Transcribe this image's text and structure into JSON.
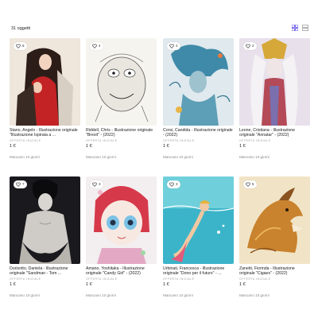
{
  "header": {
    "count_label": "31 oggetti"
  },
  "view_toggle": {
    "active": "grid",
    "accent": "#6b5ce7"
  },
  "items": [
    {
      "fav_count": "8",
      "title": "Stano, Angelo - Illustrazione originale \"Illustrazione Ispirata a ...",
      "status": "OFFERTA INIZIALE",
      "price": "1 €",
      "time": "Mancano 10 giorni"
    },
    {
      "fav_count": "4",
      "title": "Riddell, Chris - Illustrazione originale \"Brexit\" - (2022)",
      "status": "OFFERTA INIZIALE",
      "price": "1 €",
      "time": "Mancano 10 giorni"
    },
    {
      "fav_count": "2",
      "title": "Corsi, Candida - Illustrazione originale - (2022)",
      "status": "OFFERTA INIZIALE",
      "price": "1 €",
      "time": "Mancano 10 giorni"
    },
    {
      "fav_count": "2",
      "title": "Leone, Cristiana - Illustrazione originale \"Annatar\" - (2022)",
      "status": "OFFERTA INIZIALE",
      "price": "1 €",
      "time": "Mancano 10 giorni"
    },
    {
      "fav_count": "7",
      "title": "Durisotto, Daniela - Illustrazione originale \"Sandman - Tom ...",
      "status": "OFFERTA INIZIALE",
      "price": "1 €",
      "time": "Mancano 10 giorni"
    },
    {
      "fav_count": "3",
      "title": "Amano, Yoshitaka - Illustrazione originale \"Candy Girl\" - (2022)",
      "status": "OFFERTA INIZIALE",
      "price": "1 €",
      "time": "Mancano 10 giorni"
    },
    {
      "fav_count": "3",
      "title": "Urbinati, Francesca - Illustrazione originale \"Dono per il futuro\" - ...",
      "status": "OFFERTA INIZIALE",
      "price": "1 €",
      "time": "Mancano 10 giorni"
    },
    {
      "fav_count": "5",
      "title": "Zanetti, Fiorinda - Illustrazione originale \"Cigaes\" - (2022)",
      "status": "OFFERTA INIZIALE",
      "price": "1 €",
      "time": "Mancano 10 giorni"
    }
  ]
}
